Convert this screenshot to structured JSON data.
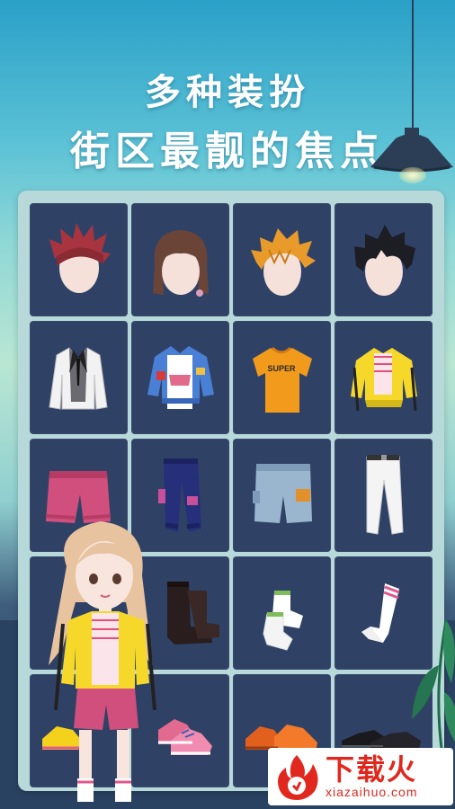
{
  "headline": {
    "line1": "多种装扮",
    "line2": "街区最靓的焦点"
  },
  "wardrobe": {
    "rows": [
      [
        {
          "item": "hair-spiky-magenta"
        },
        {
          "item": "hair-bob-brown"
        },
        {
          "item": "hair-messy-orange"
        },
        {
          "item": "hair-tousled-black"
        }
      ],
      [
        {
          "item": "tuxedo-jacket"
        },
        {
          "item": "blue-denim-jacket"
        },
        {
          "item": "orange-super-tshirt",
          "print": "SUPER"
        },
        {
          "item": "yellow-sport-jacket"
        }
      ],
      [
        {
          "item": "pink-shorts"
        },
        {
          "item": "navy-cargo-pants"
        },
        {
          "item": "denim-cargo-shorts"
        },
        {
          "item": "white-jeans"
        }
      ],
      [
        {
          "item": "empty-slot"
        },
        {
          "item": "black-boots"
        },
        {
          "item": "white-ankle-socks"
        },
        {
          "item": "white-striped-socks"
        }
      ],
      [
        {
          "item": "yellow-sneakers"
        },
        {
          "item": "pink-sneakers"
        },
        {
          "item": "orange-leather-shoes"
        },
        {
          "item": "black-dress-shoes"
        }
      ]
    ]
  },
  "watermark": {
    "brand": "下载火",
    "url": "xiazaihuo.com",
    "color": "#e0281e"
  },
  "colors": {
    "cell_bg": "#2f4266",
    "panel_bg": "#b8d9d9"
  }
}
